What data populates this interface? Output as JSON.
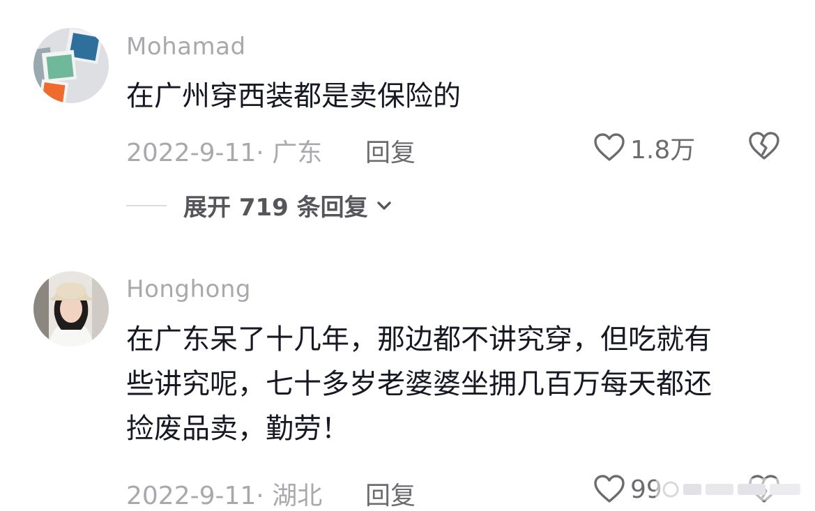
{
  "comments": [
    {
      "username": "Mohamad",
      "lines": [
        "在广州穿西装都是卖保险的"
      ],
      "date_location": "2022-9-11· 广东",
      "reply_label": "回复",
      "like_count": "1.8万",
      "expand_replies_label": "展开 719 条回复"
    },
    {
      "username": "Honghong",
      "lines": [
        "在广东呆了十几年，那边都不讲究穿，但吃就有",
        "些讲究呢，七十多岁老婆婆坐拥几百万每天都还",
        "捡废品卖，勤劳！"
      ],
      "date_location": "2022-9-11· 湖北",
      "reply_label": "回复",
      "like_count": "99"
    }
  ],
  "icons": {
    "like": "heart-outline-icon",
    "dislike": "broken-heart-icon",
    "expand": "chevron-down-icon"
  },
  "colors": {
    "username": "#a8a8ad",
    "text": "#161823",
    "meta": "#a8a8ad",
    "action": "#6b6b70"
  }
}
